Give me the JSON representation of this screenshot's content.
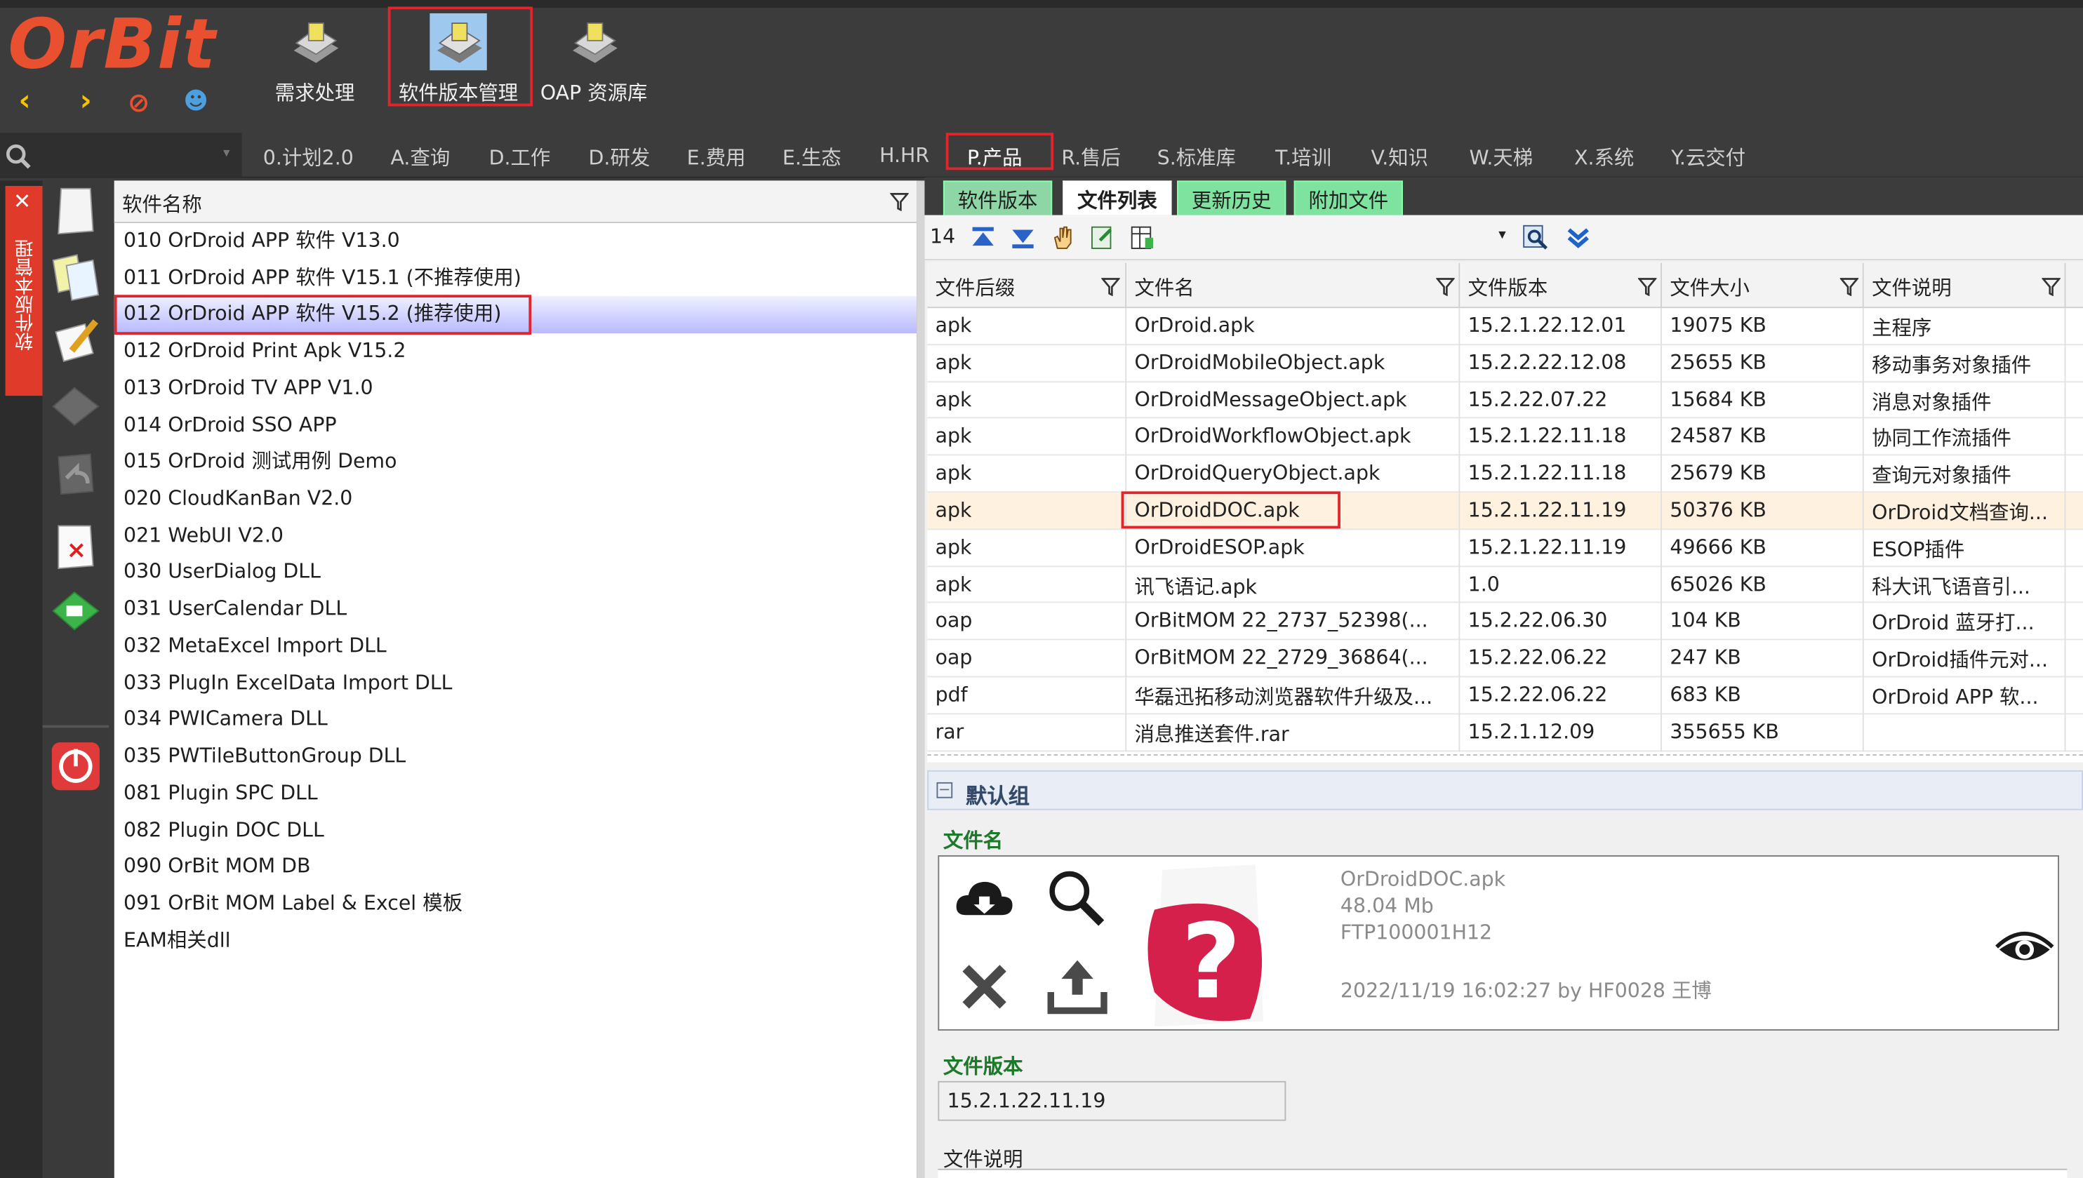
{
  "app": {
    "logo": "OrBit",
    "ribbon": [
      {
        "label": "需求处理"
      },
      {
        "label": "软件版本管理"
      },
      {
        "label": "OAP 资源库"
      }
    ],
    "menu": [
      "0.计划2.0",
      "A.查询",
      "D.工作",
      "D.研发",
      "E.费用",
      "E.生态",
      "H.HR",
      "P.产品",
      "R.售后",
      "S.标准库",
      "T.培训",
      "V.知识",
      "W.天梯",
      "X.系统",
      "Y.云交付"
    ],
    "side_tab": "软件版本管理"
  },
  "left_list": {
    "header": "软件名称",
    "items": [
      "010 OrDroid APP 软件 V13.0",
      "011 OrDroid APP 软件 V15.1 (不推荐使用)",
      "012 OrDroid APP 软件 V15.2 (推荐使用)",
      "012 OrDroid Print Apk V15.2",
      "013 OrDroid TV APP V1.0",
      "014 OrDroid SSO APP",
      "015 OrDroid 测试用例 Demo",
      "020 CloudKanBan V2.0",
      "021 WebUI V2.0",
      "030 UserDialog DLL",
      "031 UserCalendar DLL",
      "032 MetaExcel Import DLL",
      "033 PlugIn ExcelData Import DLL",
      "034 PWICamera DLL",
      "035 PWTileButtonGroup DLL",
      "081 Plugin SPC DLL",
      "082 Plugin DOC DLL",
      "090 OrBit MOM DB",
      "091 OrBit MOM Label & Excel 模板",
      "EAM相关dll"
    ],
    "selected_index": 2
  },
  "tabs": [
    {
      "label": "软件版本",
      "color": "#8fd6a7"
    },
    {
      "label": "文件列表",
      "color": "#ffffff"
    },
    {
      "label": "更新历史",
      "color": "#7fe3a0"
    },
    {
      "label": "附加文件",
      "color": "#7fe3a0"
    }
  ],
  "toolbar": {
    "count": "14"
  },
  "grid": {
    "columns": [
      "文件后缀",
      "文件名",
      "文件版本",
      "文件大小",
      "文件说明"
    ],
    "rows": [
      [
        "apk",
        "OrDroid.apk",
        "15.2.1.22.12.01",
        "19075 KB",
        "主程序"
      ],
      [
        "apk",
        "OrDroidMobileObject.apk",
        "15.2.2.22.12.08",
        "25655 KB",
        "移动事务对象插件"
      ],
      [
        "apk",
        "OrDroidMessageObject.apk",
        "15.2.22.07.22",
        "15684 KB",
        "消息对象插件"
      ],
      [
        "apk",
        "OrDroidWorkflowObject.apk",
        "15.2.1.22.11.18",
        "24587 KB",
        "协同工作流插件"
      ],
      [
        "apk",
        "OrDroidQueryObject.apk",
        "15.2.1.22.11.18",
        "25679 KB",
        "查询元对象插件"
      ],
      [
        "apk",
        "OrDroidDOC.apk",
        "15.2.1.22.11.19",
        "50376 KB",
        "OrDroid文档查询..."
      ],
      [
        "apk",
        "OrDroidESOP.apk",
        "15.2.1.22.11.19",
        "49666 KB",
        "ESOP插件"
      ],
      [
        "apk",
        "讯飞语记.apk",
        "1.0",
        "65026 KB",
        "科大讯飞语音引..."
      ],
      [
        "oap",
        "OrBitMOM 22_2737_52398(...",
        "15.2.22.06.30",
        "104 KB",
        "OrDroid 蓝牙打..."
      ],
      [
        "oap",
        "OrBitMOM 22_2729_36864(...",
        "15.2.22.06.22",
        "247 KB",
        "OrDroid插件元对..."
      ],
      [
        "pdf",
        "华磊迅拓移动浏览器软件升级及...",
        "15.2.22.06.22",
        "683 KB",
        "OrDroid APP 软..."
      ],
      [
        "rar",
        "消息推送套件.rar",
        "15.2.1.12.09",
        "355655 KB",
        ""
      ]
    ],
    "selected_index": 5
  },
  "detail": {
    "group": "默认组",
    "file_label": "文件名",
    "file_name": "OrDroidDOC.apk",
    "file_size": "48.04 Mb",
    "file_code": "FTP100001H12",
    "uploaded": "2022/11/19 16:02:27  by  HF0028 王博",
    "version_label": "文件版本",
    "version_value": "15.2.1.22.11.19",
    "desc_label": "文件说明"
  },
  "colors": {
    "accent": "#e0262c",
    "brand": "#e8502f",
    "selected_row": "#b9b9ff"
  }
}
